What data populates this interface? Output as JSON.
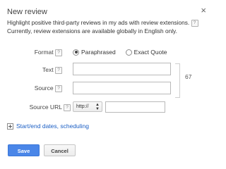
{
  "dialog": {
    "title": "New review",
    "close_glyph": "×",
    "description_line1": "Highlight positive third-party reviews in my ads with review extensions.",
    "description_line2": "Currently, review extensions are available globally in English only."
  },
  "form": {
    "format_label": "Format",
    "format_options": [
      "Paraphrased",
      "Exact Quote"
    ],
    "format_selected": "Paraphrased",
    "text_label": "Text",
    "text_value": "",
    "source_label": "Source",
    "source_value": "",
    "char_count": "67",
    "source_url_label": "Source URL",
    "protocol_selected": "http://",
    "url_value": "",
    "help_glyph": "?"
  },
  "expander": {
    "label": "Start/end dates, scheduling"
  },
  "buttons": {
    "save_label": "Save",
    "cancel_label": "Cancel"
  },
  "colors": {
    "link": "#1a5ec4",
    "primary_button": "#4a86e8"
  },
  "icons": [
    "help-icon",
    "close-icon",
    "expand-plus-icon",
    "stepper-icon"
  ]
}
